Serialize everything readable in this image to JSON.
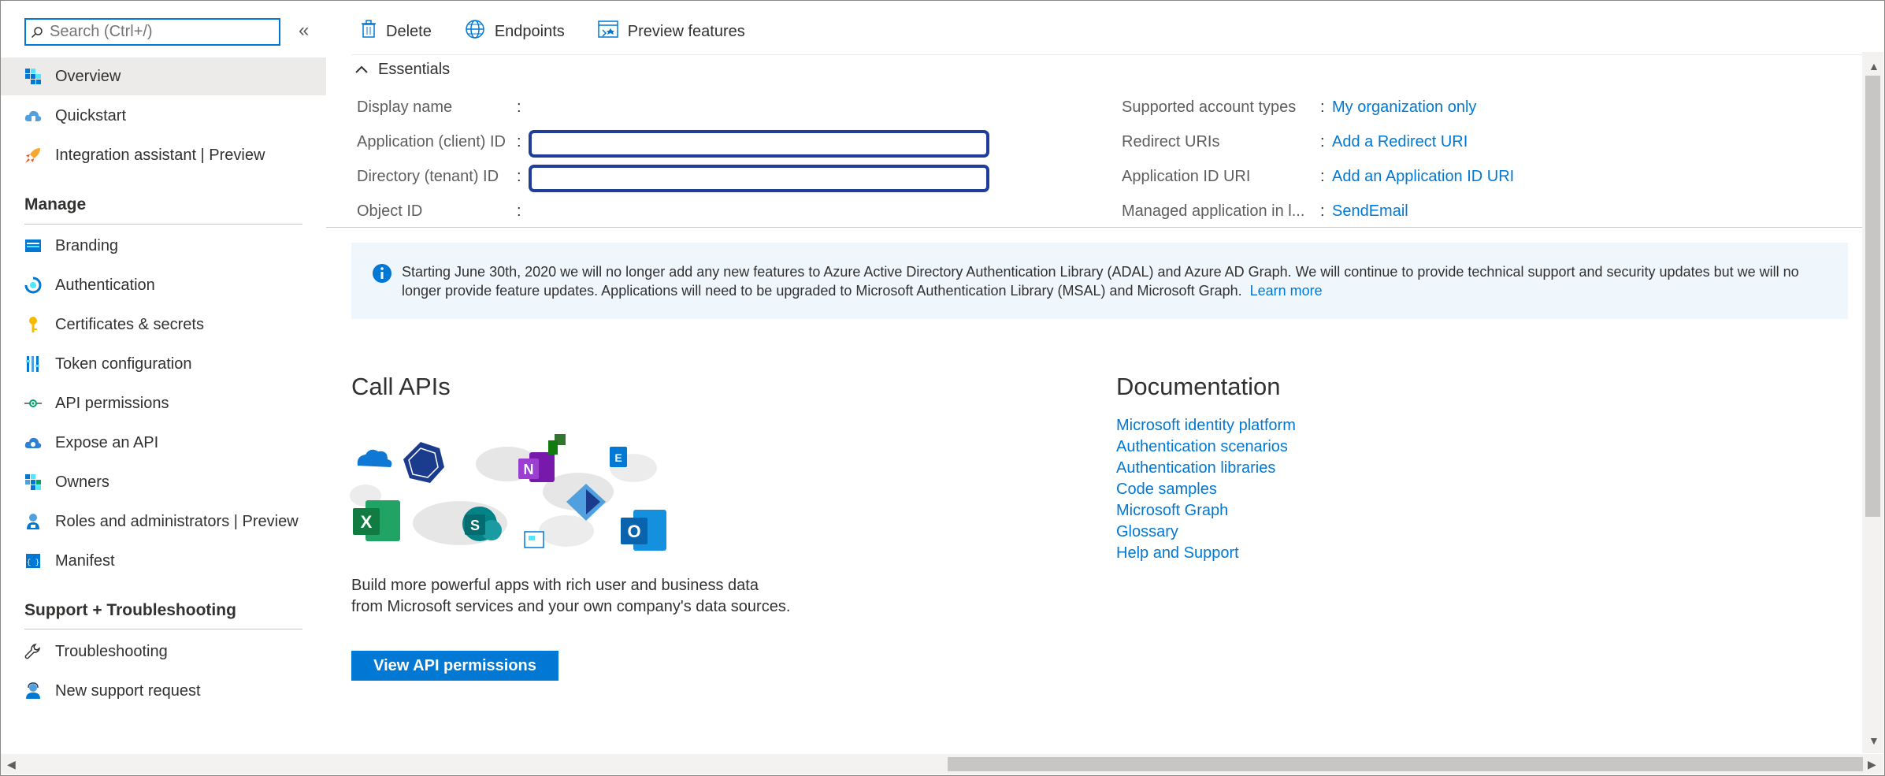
{
  "sidebar": {
    "search_placeholder": "Search (Ctrl+/)",
    "collapse_glyph": "«",
    "top_items": [
      {
        "label": "Overview",
        "icon": "overview-grid-icon"
      },
      {
        "label": "Quickstart",
        "icon": "quickstart-cloud-icon"
      },
      {
        "label": "Integration assistant | Preview",
        "icon": "rocket-icon"
      }
    ],
    "manage_heading": "Manage",
    "manage_items": [
      {
        "label": "Branding",
        "icon": "branding-icon"
      },
      {
        "label": "Authentication",
        "icon": "authentication-icon"
      },
      {
        "label": "Certificates & secrets",
        "icon": "key-icon"
      },
      {
        "label": "Token configuration",
        "icon": "token-bars-icon"
      },
      {
        "label": "API permissions",
        "icon": "api-permissions-icon"
      },
      {
        "label": "Expose an API",
        "icon": "cloud-api-icon"
      },
      {
        "label": "Owners",
        "icon": "owners-grid-icon"
      },
      {
        "label": "Roles and administrators | Preview",
        "icon": "roles-user-icon"
      },
      {
        "label": "Manifest",
        "icon": "manifest-icon"
      }
    ],
    "support_heading": "Support + Troubleshooting",
    "support_items": [
      {
        "label": "Troubleshooting",
        "icon": "wrench-icon"
      },
      {
        "label": "New support request",
        "icon": "support-person-icon"
      }
    ]
  },
  "toolbar": {
    "delete_label": "Delete",
    "endpoints_label": "Endpoints",
    "preview_label": "Preview features"
  },
  "essentials": {
    "heading": "Essentials",
    "left": [
      {
        "label": "Display name",
        "value": ""
      },
      {
        "label": "Application (client) ID",
        "value": ""
      },
      {
        "label": "Directory (tenant) ID",
        "value": ""
      },
      {
        "label": "Object ID",
        "value": ""
      }
    ],
    "right": [
      {
        "label": "Supported account types",
        "value": "My organization only"
      },
      {
        "label": "Redirect URIs",
        "value": "Add a Redirect URI"
      },
      {
        "label": "Application ID URI",
        "value": "Add an Application ID URI"
      },
      {
        "label": "Managed application in l...",
        "value": "SendEmail"
      }
    ]
  },
  "banner": {
    "text": "Starting June 30th, 2020 we will no longer add any new features to Azure Active Directory Authentication Library (ADAL) and Azure AD Graph. We will continue to provide technical support and security updates but we will no longer provide feature updates. Applications will need to be upgraded to Microsoft Authentication Library (MSAL) and Microsoft Graph.",
    "link": "Learn more"
  },
  "call_apis": {
    "heading": "Call APIs",
    "description": "Build more powerful apps with rich user and business data from Microsoft services and your own company's data sources.",
    "button": "View API permissions"
  },
  "documentation": {
    "heading": "Documentation",
    "links": [
      "Microsoft identity platform",
      "Authentication scenarios",
      "Authentication libraries",
      "Code samples",
      "Microsoft Graph",
      "Glossary",
      "Help and Support"
    ]
  },
  "colors": {
    "accent": "#0078d4",
    "selected_bg": "#edebe9",
    "id_box_border": "#1f3d99"
  }
}
